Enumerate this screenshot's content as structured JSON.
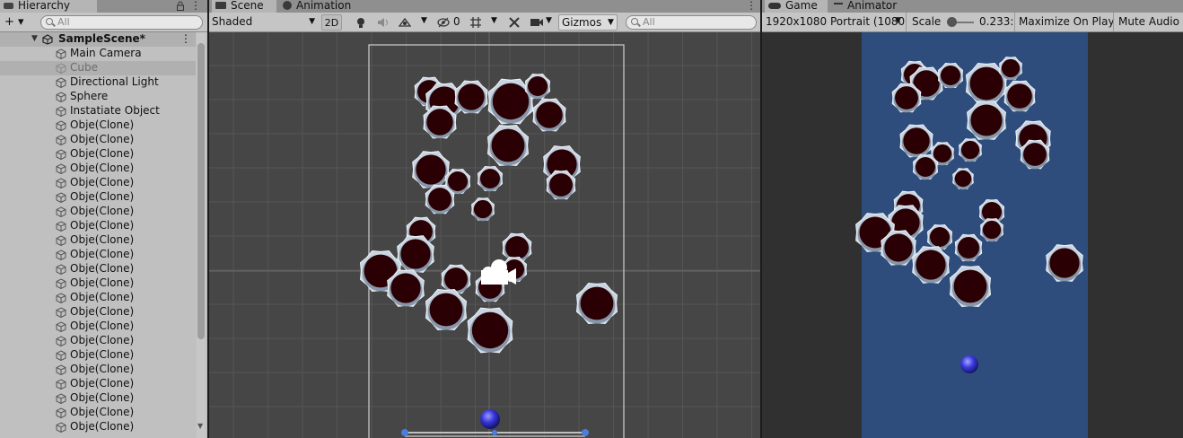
{
  "hierarchy": {
    "tab_label": "Hierarchy",
    "add_button": "+ ▾",
    "search_placeholder": "All",
    "scene_name": "SampleScene*",
    "items": [
      {
        "label": "Main Camera"
      },
      {
        "label": "Cube"
      },
      {
        "label": "Directional Light"
      },
      {
        "label": "Sphere"
      },
      {
        "label": "Instatiate Object"
      },
      {
        "label": "Obje(Clone)"
      },
      {
        "label": "Obje(Clone)"
      },
      {
        "label": "Obje(Clone)"
      },
      {
        "label": "Obje(Clone)"
      },
      {
        "label": "Obje(Clone)"
      },
      {
        "label": "Obje(Clone)"
      },
      {
        "label": "Obje(Clone)"
      },
      {
        "label": "Obje(Clone)"
      },
      {
        "label": "Obje(Clone)"
      },
      {
        "label": "Obje(Clone)"
      },
      {
        "label": "Obje(Clone)"
      },
      {
        "label": "Obje(Clone)"
      },
      {
        "label": "Obje(Clone)"
      },
      {
        "label": "Obje(Clone)"
      },
      {
        "label": "Obje(Clone)"
      },
      {
        "label": "Obje(Clone)"
      },
      {
        "label": "Obje(Clone)"
      },
      {
        "label": "Obje(Clone)"
      },
      {
        "label": "Obje(Clone)"
      },
      {
        "label": "Obje(Clone)"
      },
      {
        "label": "Obje(Clone)"
      },
      {
        "label": "Obje(Clone)"
      }
    ]
  },
  "scene": {
    "tab_label": "Scene",
    "animation_tab_label": "Animation",
    "shading_mode": "Shaded",
    "mode_2d": "2D",
    "hidden_count": "0",
    "gizmos_label": "Gizmos",
    "search_placeholder": "All"
  },
  "game": {
    "tab_label": "Game",
    "animator_tab_label": "Animator",
    "resolution": "1920x1080 Portrait (1080",
    "scale_label": "Scale",
    "scale_value": "0.233:",
    "scale_fraction": 0.1,
    "maximize_label": "Maximize On Play",
    "mute_label": "Mute Audio"
  },
  "colors": {
    "game_background": "#2f4d7c",
    "scene_background": "#464646",
    "blob_fill": "#2a0004",
    "ball": "#3a3ae0"
  }
}
